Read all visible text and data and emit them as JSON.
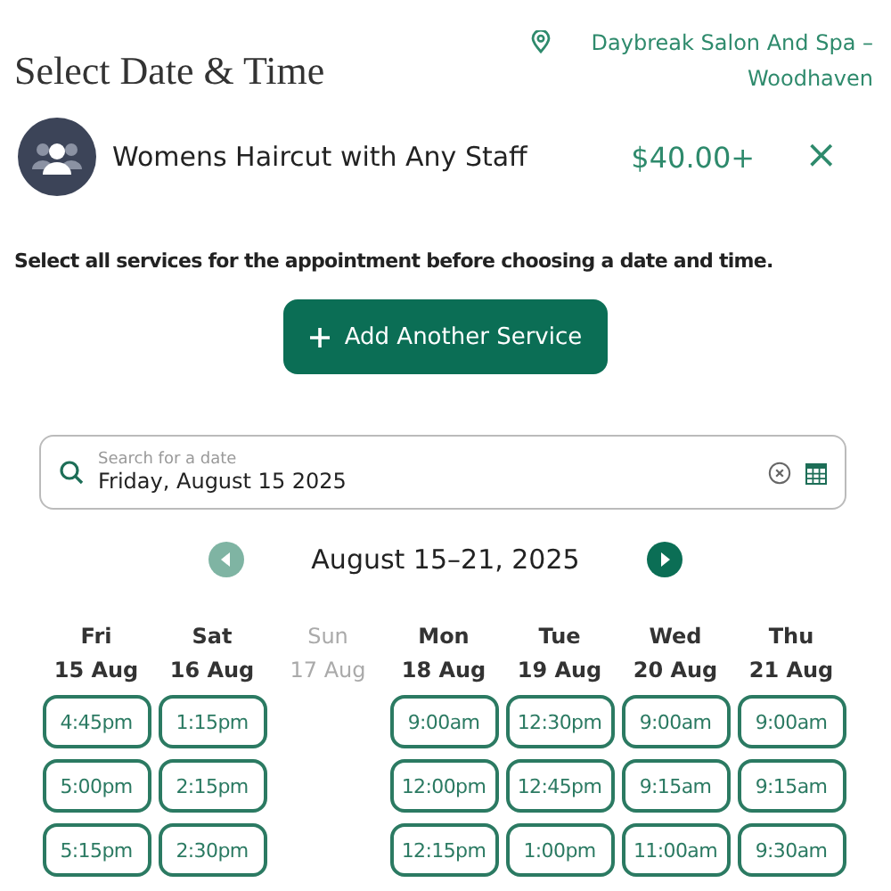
{
  "title": "Select Date & Time",
  "location": "Daybreak Salon And Spa – Woodhaven",
  "service": {
    "name": "Womens Haircut with Any Staff",
    "price": "$40.00+",
    "remove": "×"
  },
  "note": "Select all services for the appointment before choosing a date and time.",
  "add_button": "Add Another Service",
  "date_search": {
    "placeholder": "Search for a date",
    "value": "Friday, August 15 2025"
  },
  "week": {
    "label": "August 15–21, 2025",
    "prev_disabled": true,
    "next_disabled": false
  },
  "days": [
    {
      "day": "Fri",
      "date": "15 Aug",
      "available": true,
      "slots": [
        "4:45pm",
        "5:00pm",
        "5:15pm"
      ]
    },
    {
      "day": "Sat",
      "date": "16 Aug",
      "available": true,
      "slots": [
        "1:15pm",
        "2:15pm",
        "2:30pm"
      ]
    },
    {
      "day": "Sun",
      "date": "17 Aug",
      "available": false
    },
    {
      "day": "Mon",
      "date": "18 Aug",
      "available": true,
      "slots": [
        "9:00am",
        "12:00pm",
        "12:15pm"
      ]
    },
    {
      "day": "Tue",
      "date": "19 Aug",
      "available": true,
      "slots": [
        "12:30pm",
        "12:45pm",
        "1:00pm"
      ]
    },
    {
      "day": "Wed",
      "date": "20 Aug",
      "available": true,
      "slots": [
        "9:00am",
        "9:15am",
        "11:00am"
      ]
    },
    {
      "day": "Thu",
      "date": "21 Aug",
      "available": true,
      "slots": [
        "9:00am",
        "9:15am",
        "9:30am"
      ]
    }
  ]
}
